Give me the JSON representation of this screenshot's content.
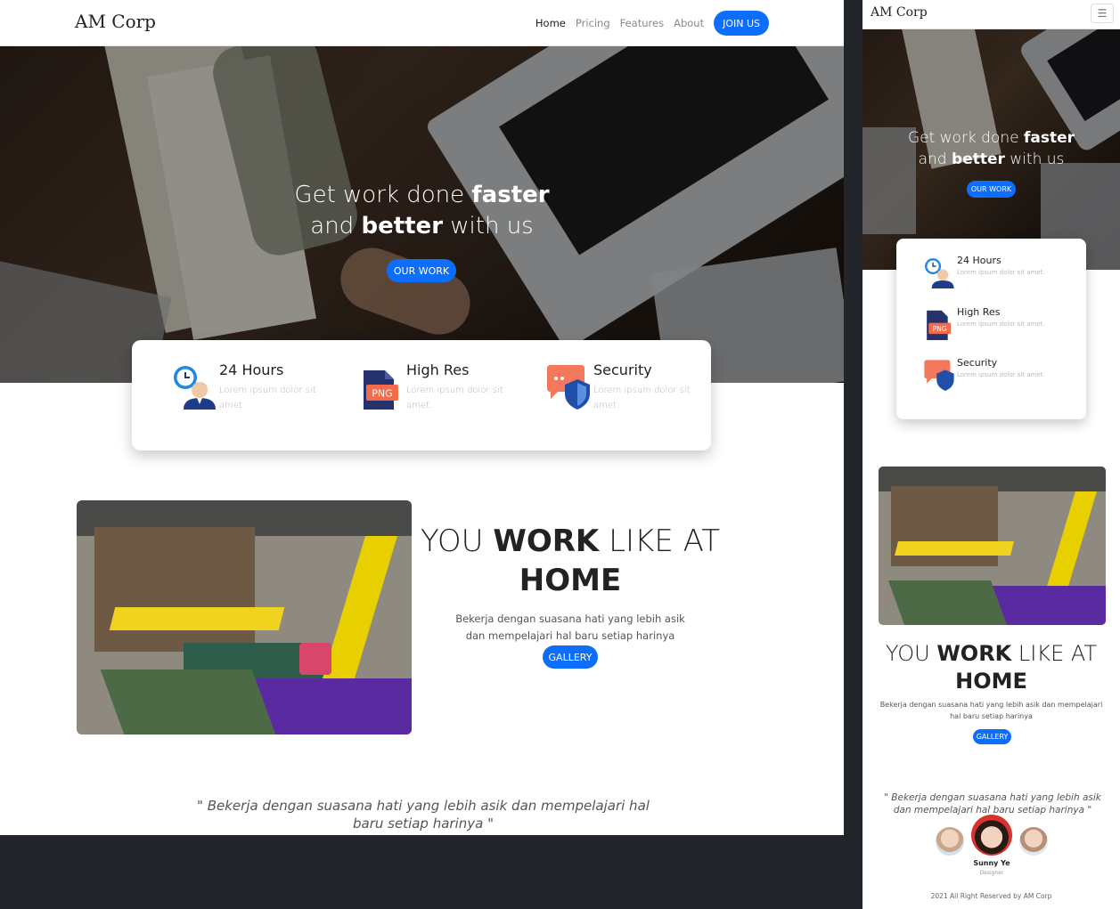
{
  "brand": "AM Corp",
  "nav": {
    "links": [
      "Home",
      "Pricing",
      "Features",
      "About"
    ],
    "active": "Home",
    "join_label": "JOIN US"
  },
  "hero": {
    "line1_pre": "Get work done ",
    "line1_bold": "faster",
    "line2_pre": "and ",
    "line2_bold": "better",
    "line2_post": " with us",
    "cta": "OUR WORK"
  },
  "features": [
    {
      "title": "24 Hours",
      "desc": "Lorem ipsum dolor sit amet.",
      "icon": "clock-person-icon"
    },
    {
      "title": "High Res",
      "desc": "Lorem ipsum dolor sit amet.",
      "icon": "png-file-icon"
    },
    {
      "title": "Security",
      "desc": "Lorem ipsum dolor sit amet.",
      "icon": "shield-chat-icon"
    }
  ],
  "work": {
    "pre": "YOU ",
    "bold": "WORK",
    "post": " LIKE AT",
    "line2": "HOME",
    "desc": "Bekerja dengan suasana hati yang lebih asik dan mempelajari hal baru setiap harinya",
    "cta": "GALLERY"
  },
  "quote": "\" Bekerja dengan suasana hati yang lebih asik dan mempelajari hal baru setiap harinya \"",
  "testimonial": {
    "name": "Sunny Ye",
    "role": "Designer"
  },
  "footer": "2021 All Right Reserved by AM Corp",
  "colors": {
    "primary": "#0d6efd",
    "dark_bg": "#22262b"
  }
}
